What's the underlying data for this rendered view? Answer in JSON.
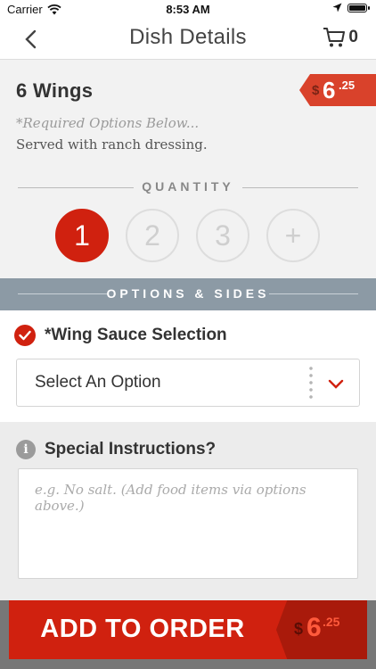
{
  "status_bar": {
    "carrier": "Carrier",
    "time": "8:53 AM"
  },
  "navbar": {
    "title": "Dish Details",
    "cart_count": "0"
  },
  "dish": {
    "name": "6 Wings",
    "price": {
      "currency": "$",
      "integer": "6",
      "decimal": ".25"
    },
    "required_note": "*Required Options Below...",
    "description": "Served with ranch dressing."
  },
  "quantity": {
    "label": "QUANTITY",
    "options": [
      "1",
      "2",
      "3",
      "+"
    ],
    "selected": "1"
  },
  "options_header": "OPTIONS & SIDES",
  "option_group": {
    "title": "*Wing Sauce Selection",
    "selected_value": "Select An Option"
  },
  "special_instructions": {
    "title": "Special Instructions?",
    "placeholder": "e.g. No salt. (Add food items via options above.)"
  },
  "add_to_order": {
    "label": "ADD TO ORDER",
    "price": {
      "currency": "$",
      "integer": "6",
      "decimal": ".25"
    }
  },
  "colors": {
    "accent": "#d0210f",
    "header_gray": "#8c9aa5"
  }
}
